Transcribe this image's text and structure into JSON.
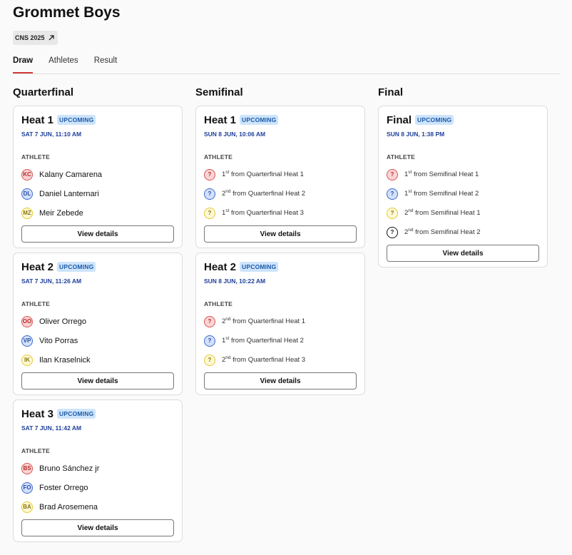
{
  "page": {
    "title": "Grommet Boys",
    "badge": "CNS 2025",
    "accent": "#d23b3b"
  },
  "tabs": [
    {
      "label": "Draw"
    },
    {
      "label": "Athletes"
    },
    {
      "label": "Result"
    }
  ],
  "quarterfinal": {
    "title": "Quarterfinal",
    "heats": [
      {
        "name": "Heat 1",
        "status": "UPCOMING",
        "time": "SAT 7 JUN, 11:10 AM",
        "athlete_label": "ATHLETE",
        "button": "View details",
        "athletes": [
          {
            "initials": "KC",
            "name": "Kalany Camarena"
          },
          {
            "initials": "DL",
            "name": "Daniel Lanternari"
          },
          {
            "initials": "MZ",
            "name": "Meir Zebede"
          }
        ]
      },
      {
        "name": "Heat 2",
        "status": "UPCOMING",
        "time": "SAT 7 JUN, 11:26 AM",
        "athlete_label": "ATHLETE",
        "button": "View details",
        "athletes": [
          {
            "initials": "OO",
            "name": "Oliver Orrego"
          },
          {
            "initials": "VP",
            "name": "Vito Porras"
          },
          {
            "initials": "IK",
            "name": "Ilan Kraselnick"
          }
        ]
      },
      {
        "name": "Heat 3",
        "status": "UPCOMING",
        "time": "SAT 7 JUN, 11:42 AM",
        "athlete_label": "ATHLETE",
        "button": "View details",
        "athletes": [
          {
            "initials": "BS",
            "name": "Bruno Sánchez jr"
          },
          {
            "initials": "FO",
            "name": "Foster Orrego"
          },
          {
            "initials": "BA",
            "name": "Brad Arosemena"
          }
        ]
      }
    ]
  },
  "semifinal": {
    "title": "Semifinal",
    "heats": [
      {
        "name": "Heat 1",
        "status": "UPCOMING",
        "time": "SUN 8 JUN, 10:06 AM",
        "athlete_label": "ATHLETE",
        "button": "View details",
        "athletes": [
          {
            "mark": "?",
            "num": "1",
            "sup": "st",
            "rest": " from Quarterfinal Heat 1"
          },
          {
            "mark": "?",
            "num": "2",
            "sup": "nd",
            "rest": " from Quarterfinal Heat 2"
          },
          {
            "mark": "?",
            "num": "1",
            "sup": "st",
            "rest": " from Quarterfinal Heat 3"
          }
        ]
      },
      {
        "name": "Heat 2",
        "status": "UPCOMING",
        "time": "SUN 8 JUN, 10:22 AM",
        "athlete_label": "ATHLETE",
        "button": "View details",
        "athletes": [
          {
            "mark": "?",
            "num": "2",
            "sup": "nd",
            "rest": " from Quarterfinal Heat 1"
          },
          {
            "mark": "?",
            "num": "1",
            "sup": "st",
            "rest": " from Quarterfinal Heat 2"
          },
          {
            "mark": "?",
            "num": "2",
            "sup": "nd",
            "rest": " from Quarterfinal Heat 3"
          }
        ]
      }
    ]
  },
  "final": {
    "title": "Final",
    "heat": {
      "name": "Final",
      "status": "UPCOMING",
      "time": "SUN 8 JUN, 1:38 PM",
      "athlete_label": "ATHLETE",
      "button": "View details",
      "athletes": [
        {
          "mark": "?",
          "num": "1",
          "sup": "st",
          "rest": " from Semifinal Heat 1"
        },
        {
          "mark": "?",
          "num": "1",
          "sup": "st",
          "rest": " from Semifinal Heat 2"
        },
        {
          "mark": "?",
          "num": "2",
          "sup": "nd",
          "rest": " from Semifinal Heat 1"
        },
        {
          "mark": "?",
          "num": "2",
          "sup": "nd",
          "rest": " from Semifinal Heat 2"
        }
      ]
    }
  }
}
